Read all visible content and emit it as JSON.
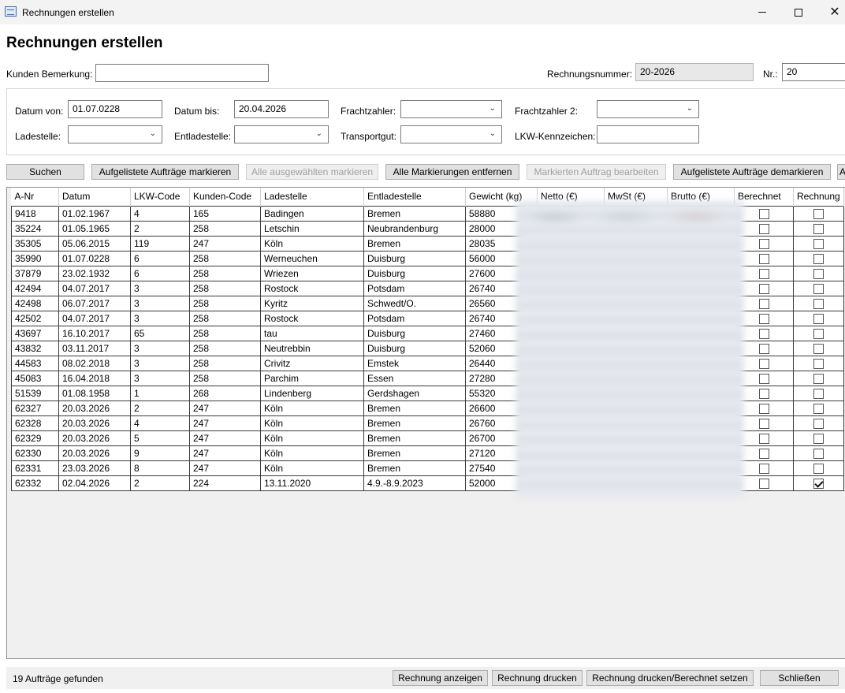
{
  "window": {
    "title": "Rechnungen erstellen",
    "min_label": "",
    "max_label": "",
    "close_label": "✕"
  },
  "header": {
    "title": "Rechnungen erstellen"
  },
  "top": {
    "bemerkung_label": "Kunden Bemerkung:",
    "bemerkung_value": "",
    "rechnungsnummer_label": "Rechnungsnummer:",
    "rechnungsnummer_value": "20-2026",
    "nr_label": "Nr.:",
    "nr_value": "20"
  },
  "filters": {
    "datum_von_label": "Datum von:",
    "datum_von_value": "01.07.0228",
    "datum_bis_label": "Datum bis:",
    "datum_bis_value": "20.04.2026",
    "frachtzahler_label": "Frachtzahler:",
    "frachtzahler2_label": "Frachtzahler 2:",
    "ladestelle_label": "Ladestelle:",
    "entladestelle_label": "Entladestelle:",
    "transportgut_label": "Transportgut:",
    "lkw_kennzeichen_label": "LKW-Kennzeichen:",
    "lkw_kennzeichen_value": ""
  },
  "toolbar": {
    "suchen": "Suchen",
    "markieren": "Aufgelistete Aufträge markieren",
    "alle_ausgewaehlten": "Alle ausgewählten markieren",
    "alle_entfernen": "Alle Markierungen entfernen",
    "bearbeiten": "Markierten Auftrag bearbeiten",
    "demarkieren": "Aufgelistete Aufträge demarkieren",
    "overflow": "A"
  },
  "table": {
    "columns": [
      "A-Nr",
      "Datum",
      "LKW-Code",
      "Kunden-Code",
      "Ladestelle",
      "Entladestelle",
      "Gewicht (kg)",
      "Netto (€)",
      "MwSt (€)",
      "Brutto (€)",
      "Berechnet",
      "Rechnung"
    ],
    "rows": [
      {
        "anr": "9418",
        "datum": "01.02.1967",
        "lkw": "4",
        "kunde": "165",
        "lade": "Badingen",
        "entlade": "Bremen",
        "gewicht": "58880",
        "berechnet": false,
        "rechnung": false
      },
      {
        "anr": "35224",
        "datum": "01.05.1965",
        "lkw": "2",
        "kunde": "258",
        "lade": "Letschin",
        "entlade": "Neubrandenburg",
        "gewicht": "28000",
        "berechnet": false,
        "rechnung": false
      },
      {
        "anr": "35305",
        "datum": "05.06.2015",
        "lkw": "119",
        "kunde": "247",
        "lade": "Köln",
        "entlade": "Bremen",
        "gewicht": "28035",
        "berechnet": false,
        "rechnung": false
      },
      {
        "anr": "35990",
        "datum": "01.07.0228",
        "lkw": "6",
        "kunde": "258",
        "lade": "Werneuchen",
        "entlade": "Duisburg",
        "gewicht": "56000",
        "berechnet": false,
        "rechnung": false
      },
      {
        "anr": "37879",
        "datum": "23.02.1932",
        "lkw": "6",
        "kunde": "258",
        "lade": "Wriezen",
        "entlade": "Duisburg",
        "gewicht": "27600",
        "berechnet": false,
        "rechnung": false
      },
      {
        "anr": "42494",
        "datum": "04.07.2017",
        "lkw": "3",
        "kunde": "258",
        "lade": "Rostock",
        "entlade": "Potsdam",
        "gewicht": "26740",
        "berechnet": false,
        "rechnung": false
      },
      {
        "anr": "42498",
        "datum": "06.07.2017",
        "lkw": "3",
        "kunde": "258",
        "lade": "Kyritz",
        "entlade": "Schwedt/O.",
        "gewicht": "26560",
        "berechnet": false,
        "rechnung": false
      },
      {
        "anr": "42502",
        "datum": "04.07.2017",
        "lkw": "3",
        "kunde": "258",
        "lade": "Rostock",
        "entlade": "Potsdam",
        "gewicht": "26740",
        "berechnet": false,
        "rechnung": false
      },
      {
        "anr": "43697",
        "datum": "16.10.2017",
        "lkw": "65",
        "kunde": "258",
        "lade": "tau",
        "entlade": "Duisburg",
        "gewicht": "27460",
        "berechnet": false,
        "rechnung": false
      },
      {
        "anr": "43832",
        "datum": "03.11.2017",
        "lkw": "3",
        "kunde": "258",
        "lade": "Neutrebbin",
        "entlade": "Duisburg",
        "gewicht": "52060",
        "berechnet": false,
        "rechnung": false
      },
      {
        "anr": "44583",
        "datum": "08.02.2018",
        "lkw": "3",
        "kunde": "258",
        "lade": "Crivitz",
        "entlade": "Emstek",
        "gewicht": "26440",
        "berechnet": false,
        "rechnung": false
      },
      {
        "anr": "45083",
        "datum": "16.04.2018",
        "lkw": "3",
        "kunde": "258",
        "lade": "Parchim",
        "entlade": "Essen",
        "gewicht": "27280",
        "berechnet": false,
        "rechnung": false
      },
      {
        "anr": "51539",
        "datum": "01.08.1958",
        "lkw": "1",
        "kunde": "268",
        "lade": "Lindenberg",
        "entlade": "Gerdshagen",
        "gewicht": "55320",
        "berechnet": false,
        "rechnung": false
      },
      {
        "anr": "62327",
        "datum": "20.03.2026",
        "lkw": "2",
        "kunde": "247",
        "lade": "Köln",
        "entlade": "Bremen",
        "gewicht": "26600",
        "berechnet": false,
        "rechnung": false
      },
      {
        "anr": "62328",
        "datum": "20.03.2026",
        "lkw": "4",
        "kunde": "247",
        "lade": "Köln",
        "entlade": "Bremen",
        "gewicht": "26760",
        "berechnet": false,
        "rechnung": false
      },
      {
        "anr": "62329",
        "datum": "20.03.2026",
        "lkw": "5",
        "kunde": "247",
        "lade": "Köln",
        "entlade": "Bremen",
        "gewicht": "26700",
        "berechnet": false,
        "rechnung": false
      },
      {
        "anr": "62330",
        "datum": "20.03.2026",
        "lkw": "9",
        "kunde": "247",
        "lade": "Köln",
        "entlade": "Bremen",
        "gewicht": "27120",
        "berechnet": false,
        "rechnung": false
      },
      {
        "anr": "62331",
        "datum": "23.03.2026",
        "lkw": "8",
        "kunde": "247",
        "lade": "Köln",
        "entlade": "Bremen",
        "gewicht": "27540",
        "berechnet": false,
        "rechnung": false
      },
      {
        "anr": "62332",
        "datum": "02.04.2026",
        "lkw": "2",
        "kunde": "224",
        "lade": "13.11.2020",
        "entlade": "4.9.-8.9.2023",
        "gewicht": "52000",
        "berechnet": false,
        "rechnung": true
      }
    ]
  },
  "status": {
    "count_text": "19 Aufträge gefunden",
    "anzeigen": "Rechnung anzeigen",
    "drucken": "Rechnung drucken",
    "drucken_berechnet": "Rechnung drucken/Berechnet setzen",
    "schliessen": "Schließen"
  }
}
